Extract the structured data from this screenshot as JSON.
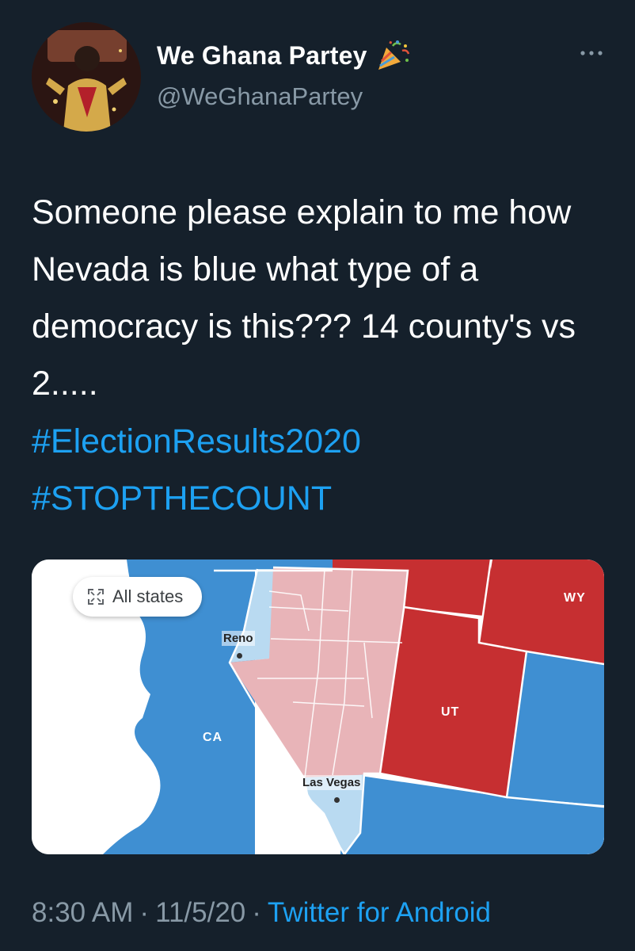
{
  "user": {
    "display_name": "We Ghana Partey",
    "handle": "@WeGhanaPartey",
    "name_emoji_icon": "party-popper-icon",
    "more_icon": "more-horizontal-icon"
  },
  "tweet": {
    "text": "Someone please explain to me how Nevada is blue what type of a democracy is this??? 14 county's vs 2.....",
    "hashtags": [
      "#ElectionResults2020",
      "#STOPTHECOUNT"
    ]
  },
  "media": {
    "all_states_label": "All states",
    "all_states_icon": "expand-icon",
    "state_labels": {
      "ca": "CA",
      "ut": "UT",
      "wy": "WY"
    },
    "city_labels": {
      "reno": "Reno",
      "las_vegas": "Las Vegas"
    },
    "colors": {
      "democrat": "#3f8fd2",
      "democrat_light": "#b9daf1",
      "republican": "#c62f31",
      "republican_light": "#e8b4b8",
      "land_boundary": "#ffffff",
      "ocean": "#ffffff"
    }
  },
  "meta": {
    "time": "8:30 AM",
    "date": "11/5/20",
    "separator": "·",
    "source": "Twitter for Android"
  }
}
